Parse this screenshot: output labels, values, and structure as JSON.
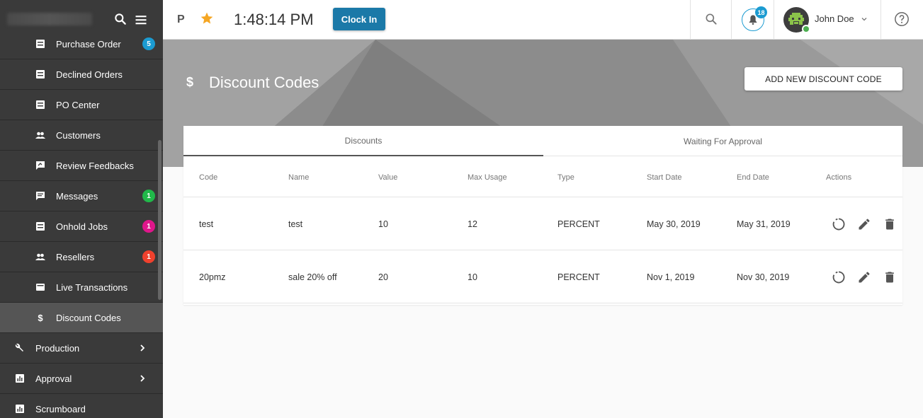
{
  "header": {
    "project_initial": "P",
    "time": "1:48:14 PM",
    "clock_in_label": "Clock In",
    "notifications_count": "18",
    "user_name": "John Doe"
  },
  "sidebar": {
    "items": [
      {
        "label": "Purchase Order",
        "badge": "5",
        "badge_color": "#1b9bd1"
      },
      {
        "label": "Declined Orders"
      },
      {
        "label": "PO Center"
      },
      {
        "label": "Customers"
      },
      {
        "label": "Review Feedbacks"
      },
      {
        "label": "Messages",
        "badge": "1",
        "badge_color": "#21b94a"
      },
      {
        "label": "Onhold Jobs",
        "badge": "1",
        "badge_color": "#e0168b"
      },
      {
        "label": "Resellers",
        "badge": "1",
        "badge_color": "#f0412d"
      },
      {
        "label": "Live Transactions"
      },
      {
        "label": "Discount Codes",
        "icon_glyph": "$"
      },
      {
        "label": "Production"
      },
      {
        "label": "Approval"
      },
      {
        "label": "Scrumboard"
      }
    ]
  },
  "page": {
    "title_icon": "$",
    "title": "Discount Codes",
    "add_button_label": "ADD NEW DISCOUNT CODE"
  },
  "tabs": [
    {
      "label": "Discounts"
    },
    {
      "label": "Waiting For Approval"
    }
  ],
  "table": {
    "columns": [
      "Code",
      "Name",
      "Value",
      "Max Usage",
      "Type",
      "Start Date",
      "End Date",
      "Actions"
    ],
    "rows": [
      {
        "code": "test",
        "name": "test",
        "value": "10",
        "max_usage": "12",
        "type": "PERCENT",
        "start_date": "May 30, 2019",
        "end_date": "May 31, 2019"
      },
      {
        "code": "20pmz",
        "name": "sale 20% off",
        "value": "20",
        "max_usage": "10",
        "type": "PERCENT",
        "start_date": "Nov 1, 2019",
        "end_date": "Nov 30, 2019"
      }
    ]
  },
  "colors": {
    "sidebar_bg": "#3a3a3a",
    "accent_blue": "#1b79a8",
    "star": "#f5a623",
    "banner": "#8a8a8a"
  }
}
